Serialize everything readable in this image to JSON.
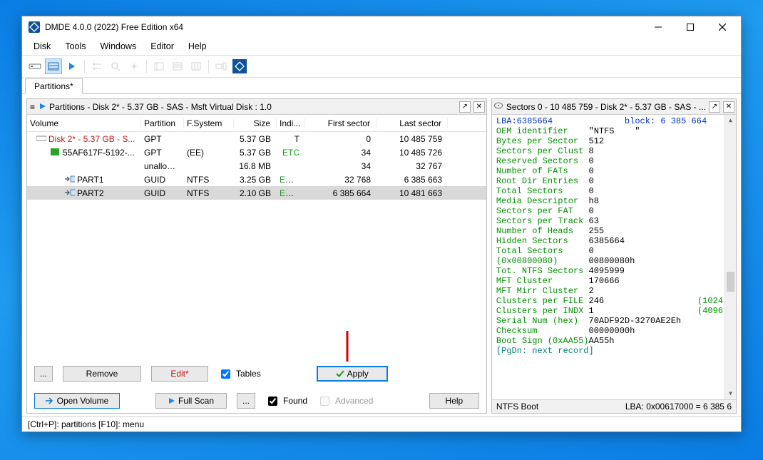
{
  "window": {
    "title": "DMDE 4.0.0 (2022) Free Edition x64"
  },
  "menu": [
    "Disk",
    "Tools",
    "Windows",
    "Editor",
    "Help"
  ],
  "tab": "Partitions*",
  "left_panel": {
    "title": "Partitions - Disk 2* - 5.37 GB - SAS - Msft Virtual Disk : 1.0",
    "columns": [
      "Volume",
      "Partition",
      "F.System",
      "Size",
      "Indi...",
      "First sector",
      "Last sector"
    ],
    "rows": [
      {
        "volume": "Disk 2* - 5.37 GB - S...",
        "partition": "GPT",
        "fsystem": "",
        "size": "5.37 GB",
        "ind": "T",
        "first": "0",
        "last": "10 485 759",
        "indent": 0,
        "red": true,
        "icon": "disk"
      },
      {
        "volume": "55AF617F-5192-...",
        "partition": "GPT",
        "fsystem": "(EE)",
        "size": "5.37 GB",
        "ind": "ETC",
        "first": "34",
        "last": "10 485 726",
        "indent": 1,
        "icon": "guid"
      },
      {
        "volume": "",
        "partition": "unalloca...",
        "fsystem": "",
        "size": "16.8 MB",
        "ind": "",
        "first": "34",
        "last": "32 767",
        "indent": 2,
        "icon": ""
      },
      {
        "volume": "PART1",
        "partition": "GUID",
        "fsystem": "NTFS",
        "size": "3.25 GB",
        "ind": "EBCF",
        "first": "32 768",
        "last": "6 385 663",
        "indent": 2,
        "icon": "vol"
      },
      {
        "volume": "PART2",
        "partition": "GUID",
        "fsystem": "NTFS",
        "size": "2.10 GB",
        "ind": "EBCF",
        "first": "6 385 664",
        "last": "10 481 663",
        "indent": 2,
        "icon": "vol",
        "selected": true
      }
    ],
    "buttons": {
      "more": "...",
      "remove": "Remove",
      "edit": "Edit*",
      "tables": "Tables",
      "apply": "Apply",
      "open_volume": "Open Volume",
      "full_scan": "Full Scan",
      "more2": "...",
      "found": "Found",
      "advanced": "Advanced",
      "help": "Help"
    }
  },
  "right_panel": {
    "title": "Sectors 0 - 10 485 759 - Disk 2* - 5.37 GB - SAS - ...",
    "header_line": {
      "left": "LBA:6385664",
      "right": "block: 6 385 664"
    },
    "records": [
      {
        "k": "OEM identifier   ",
        "v": "\"NTFS    \""
      },
      {
        "k": "Bytes per Sector ",
        "v": "512"
      },
      {
        "k": "Sectors per Clust",
        "v": "8"
      },
      {
        "k": "Reserved Sectors ",
        "v": "0"
      },
      {
        "k": "Number of FATs   ",
        "v": "0"
      },
      {
        "k": "Root Dir Entries ",
        "v": "0"
      },
      {
        "k": "Total Sectors    ",
        "v": "0"
      },
      {
        "k": "Media Descriptor ",
        "v": "h8"
      },
      {
        "k": "Sectors per FAT  ",
        "v": "0"
      },
      {
        "k": "Sectors per Track",
        "v": "63"
      },
      {
        "k": "Number of Heads  ",
        "v": "255"
      },
      {
        "k": "Hidden Sectors   ",
        "v": "6385664"
      },
      {
        "k": "Total Sectors    ",
        "v": "0"
      },
      {
        "k": "(0x00800080)     ",
        "v": "00800080h"
      },
      {
        "k": "Tot. NTFS Sectors",
        "v": "4095999"
      },
      {
        "k": "MFT Cluster      ",
        "v": "170666"
      },
      {
        "k": "MFT Mirr Cluster ",
        "v": "2"
      },
      {
        "k": "Clusters per FILE",
        "v": "246",
        "extra": "(1024"
      },
      {
        "k": "Clusters per INDX",
        "v": "1",
        "extra": "(4096"
      },
      {
        "k": "Serial Num (hex) ",
        "v": "70ADF92D-3270AE2Eh"
      },
      {
        "k": "Checksum         ",
        "v": "00000000h"
      },
      {
        "k": "Boot Sign (0xAA55)",
        "v": "AA55h",
        "tight": true
      }
    ],
    "footer_hint": "[PgDn: next record]",
    "footer_left": "NTFS Boot",
    "footer_right": "LBA: 0x00617000 = 6 385 6"
  },
  "statusbar": "[Ctrl+P]: partitions  [F10]: menu"
}
